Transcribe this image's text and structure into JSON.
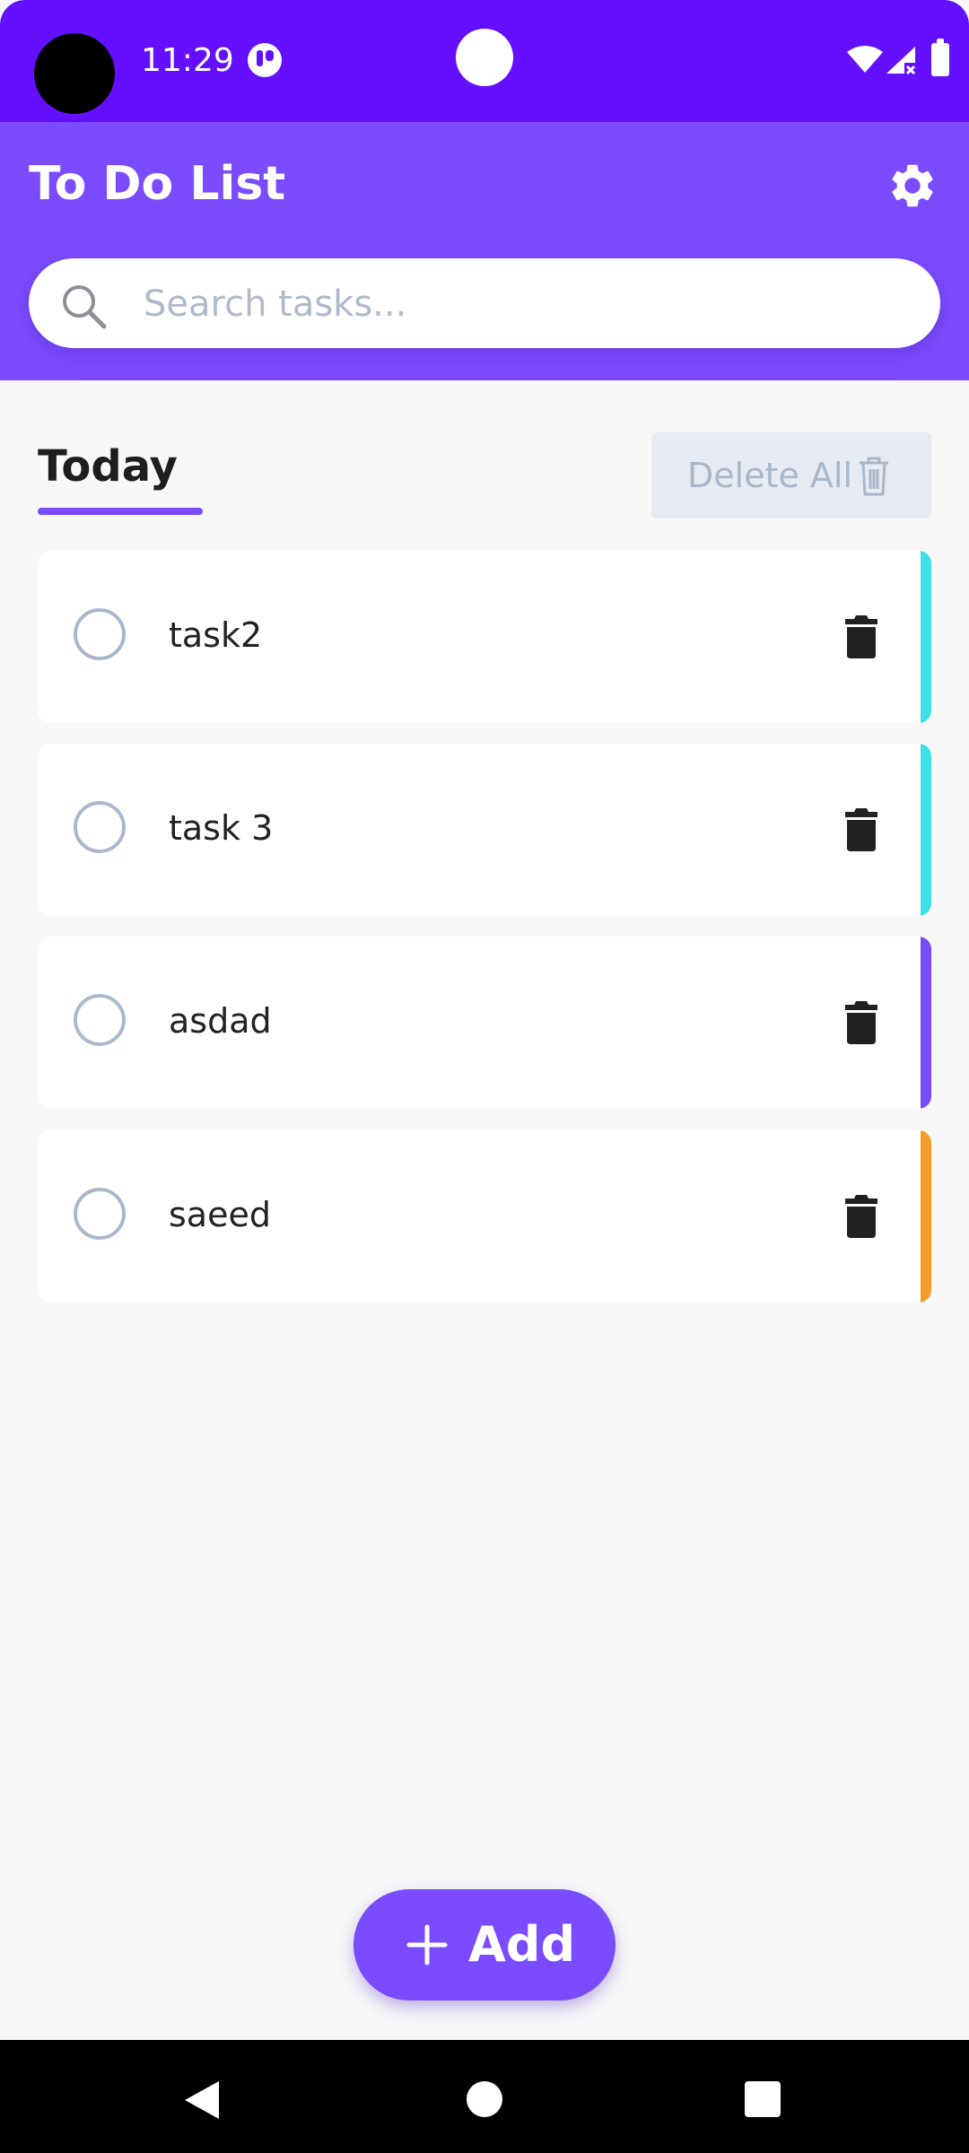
{
  "status_bar": {
    "time": "11:29"
  },
  "header": {
    "title": "To Do List",
    "search": {
      "placeholder": "Search tasks..."
    }
  },
  "section": {
    "title": "Today",
    "delete_all_label": "Delete All"
  },
  "tasks": [
    {
      "label": "task2",
      "accent_color": "#3ddfe9",
      "completed": false
    },
    {
      "label": "task 3",
      "accent_color": "#3ddfe9",
      "completed": false
    },
    {
      "label": "asdad",
      "accent_color": "#7b4cff",
      "completed": false
    },
    {
      "label": "saeed",
      "accent_color": "#f39b24",
      "completed": false
    }
  ],
  "fab": {
    "label": "Add"
  },
  "colors": {
    "status_bar": "#6410fe",
    "header": "#7b4cff",
    "accent": "#7b4cff",
    "background": "#f8f8f9"
  },
  "icons": {
    "settings": "gear-icon",
    "search": "search-icon",
    "delete": "trash-icon",
    "add": "plus-icon"
  }
}
